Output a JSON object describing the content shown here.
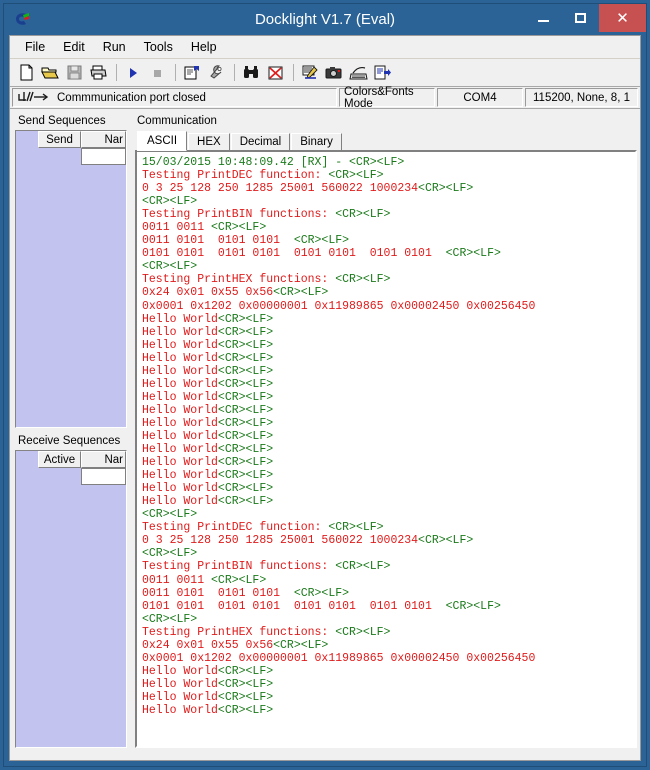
{
  "window": {
    "title": "Docklight V1.7 (Eval)",
    "app_icon": "docklight-logo-icon",
    "controls": {
      "minimize": "minimize-icon",
      "maximize": "maximize-icon",
      "close": "✕"
    }
  },
  "menubar": {
    "items": [
      {
        "label": "File"
      },
      {
        "label": "Edit"
      },
      {
        "label": "Run"
      },
      {
        "label": "Tools"
      },
      {
        "label": "Help"
      }
    ]
  },
  "toolbar": {
    "buttons": [
      {
        "name": "new-file-icon",
        "title": "New"
      },
      {
        "name": "open-file-icon",
        "title": "Open"
      },
      {
        "name": "save-file-icon",
        "title": "Save",
        "disabled": true
      },
      {
        "name": "print-icon",
        "title": "Print"
      },
      {
        "name": "start-communication-icon",
        "title": "Start Communication"
      },
      {
        "name": "stop-communication-icon",
        "title": "Stop Communication",
        "disabled": true
      },
      {
        "name": "project-settings-icon",
        "title": "Project Settings"
      },
      {
        "name": "tools-wrench-icon",
        "title": "Tools"
      },
      {
        "name": "find-binoculars-icon",
        "title": "Find"
      },
      {
        "name": "clear-communication-icon",
        "title": "Clear Communication Window"
      },
      {
        "name": "edit-mode-icon",
        "title": "Edit Mode"
      },
      {
        "name": "snapshot-camera-icon",
        "title": "Snapshot"
      },
      {
        "name": "keyboard-console-icon",
        "title": "Keyboard Console"
      },
      {
        "name": "send-file-icon",
        "title": "Send File"
      }
    ]
  },
  "statusbar": {
    "connection_icon": "serial-link-icon",
    "connection_text": "Commmunication port closed",
    "mode": "Colors&Fonts Mode",
    "port": "COM4",
    "params": "115200, None, 8, 1"
  },
  "send_sequences": {
    "title": "Send Sequences",
    "columns": [
      "Send",
      "Nar"
    ]
  },
  "receive_sequences": {
    "title": "Receive Sequences",
    "columns": [
      "Active",
      "Nar"
    ]
  },
  "communication": {
    "title": "Communication",
    "tabs": [
      {
        "label": "ASCII",
        "active": true
      },
      {
        "label": "HEX",
        "active": false
      },
      {
        "label": "Decimal",
        "active": false
      },
      {
        "label": "Binary",
        "active": false
      }
    ],
    "colors": {
      "data": "#e01b1b",
      "control": "#1a7a1a"
    },
    "lines": [
      [
        {
          "t": "15/03/2015 10:48:09.42 [RX] - <CR><LF>",
          "c": "green"
        }
      ],
      [
        {
          "t": "Testing PrintDEC function: ",
          "c": "red"
        },
        {
          "t": "<CR><LF>",
          "c": "green"
        }
      ],
      [
        {
          "t": "0 3 25 128 250 1285 25001 560022 1000234",
          "c": "red"
        },
        {
          "t": "<CR><LF>",
          "c": "green"
        }
      ],
      [
        {
          "t": "<CR><LF>",
          "c": "green"
        }
      ],
      [
        {
          "t": "Testing PrintBIN functions: ",
          "c": "red"
        },
        {
          "t": "<CR><LF>",
          "c": "green"
        }
      ],
      [
        {
          "t": "0011 0011 ",
          "c": "red"
        },
        {
          "t": "<CR><LF>",
          "c": "green"
        }
      ],
      [
        {
          "t": "0011 0101  0101 0101  ",
          "c": "red"
        },
        {
          "t": "<CR><LF>",
          "c": "green"
        }
      ],
      [
        {
          "t": "0101 0101  0101 0101  0101 0101  0101 0101  ",
          "c": "red"
        },
        {
          "t": "<CR><LF>",
          "c": "green"
        }
      ],
      [
        {
          "t": "<CR><LF>",
          "c": "green"
        }
      ],
      [
        {
          "t": "Testing PrintHEX functions: ",
          "c": "red"
        },
        {
          "t": "<CR><LF>",
          "c": "green"
        }
      ],
      [
        {
          "t": "0x24 0x01 0x55 0x56",
          "c": "red"
        },
        {
          "t": "<CR><LF>",
          "c": "green"
        }
      ],
      [
        {
          "t": "0x0001 0x1202 0x00000001 0x11989865 0x00002450 0x00256450",
          "c": "red"
        }
      ],
      [
        {
          "t": "Hello World",
          "c": "red"
        },
        {
          "t": "<CR><LF>",
          "c": "green"
        }
      ],
      [
        {
          "t": "Hello World",
          "c": "red"
        },
        {
          "t": "<CR><LF>",
          "c": "green"
        }
      ],
      [
        {
          "t": "Hello World",
          "c": "red"
        },
        {
          "t": "<CR><LF>",
          "c": "green"
        }
      ],
      [
        {
          "t": "Hello World",
          "c": "red"
        },
        {
          "t": "<CR><LF>",
          "c": "green"
        }
      ],
      [
        {
          "t": "Hello World",
          "c": "red"
        },
        {
          "t": "<CR><LF>",
          "c": "green"
        }
      ],
      [
        {
          "t": "Hello World",
          "c": "red"
        },
        {
          "t": "<CR><LF>",
          "c": "green"
        }
      ],
      [
        {
          "t": "Hello World",
          "c": "red"
        },
        {
          "t": "<CR><LF>",
          "c": "green"
        }
      ],
      [
        {
          "t": "Hello World",
          "c": "red"
        },
        {
          "t": "<CR><LF>",
          "c": "green"
        }
      ],
      [
        {
          "t": "Hello World",
          "c": "red"
        },
        {
          "t": "<CR><LF>",
          "c": "green"
        }
      ],
      [
        {
          "t": "Hello World",
          "c": "red"
        },
        {
          "t": "<CR><LF>",
          "c": "green"
        }
      ],
      [
        {
          "t": "Hello World",
          "c": "red"
        },
        {
          "t": "<CR><LF>",
          "c": "green"
        }
      ],
      [
        {
          "t": "Hello World",
          "c": "red"
        },
        {
          "t": "<CR><LF>",
          "c": "green"
        }
      ],
      [
        {
          "t": "Hello World",
          "c": "red"
        },
        {
          "t": "<CR><LF>",
          "c": "green"
        }
      ],
      [
        {
          "t": "Hello World",
          "c": "red"
        },
        {
          "t": "<CR><LF>",
          "c": "green"
        }
      ],
      [
        {
          "t": "Hello World",
          "c": "red"
        },
        {
          "t": "<CR><LF>",
          "c": "green"
        }
      ],
      [
        {
          "t": "<CR><LF>",
          "c": "green"
        }
      ],
      [
        {
          "t": "Testing PrintDEC function: ",
          "c": "red"
        },
        {
          "t": "<CR><LF>",
          "c": "green"
        }
      ],
      [
        {
          "t": "0 3 25 128 250 1285 25001 560022 1000234",
          "c": "red"
        },
        {
          "t": "<CR><LF>",
          "c": "green"
        }
      ],
      [
        {
          "t": "<CR><LF>",
          "c": "green"
        }
      ],
      [
        {
          "t": "Testing PrintBIN functions: ",
          "c": "red"
        },
        {
          "t": "<CR><LF>",
          "c": "green"
        }
      ],
      [
        {
          "t": "0011 0011 ",
          "c": "red"
        },
        {
          "t": "<CR><LF>",
          "c": "green"
        }
      ],
      [
        {
          "t": "0011 0101  0101 0101  ",
          "c": "red"
        },
        {
          "t": "<CR><LF>",
          "c": "green"
        }
      ],
      [
        {
          "t": "0101 0101  0101 0101  0101 0101  0101 0101  ",
          "c": "red"
        },
        {
          "t": "<CR><LF>",
          "c": "green"
        }
      ],
      [
        {
          "t": "<CR><LF>",
          "c": "green"
        }
      ],
      [
        {
          "t": "Testing PrintHEX functions: ",
          "c": "red"
        },
        {
          "t": "<CR><LF>",
          "c": "green"
        }
      ],
      [
        {
          "t": "0x24 0x01 0x55 0x56",
          "c": "red"
        },
        {
          "t": "<CR><LF>",
          "c": "green"
        }
      ],
      [
        {
          "t": "0x0001 0x1202 0x00000001 0x11989865 0x00002450 0x00256450",
          "c": "red"
        }
      ],
      [
        {
          "t": "Hello World",
          "c": "red"
        },
        {
          "t": "<CR><LF>",
          "c": "green"
        }
      ],
      [
        {
          "t": "Hello World",
          "c": "red"
        },
        {
          "t": "<CR><LF>",
          "c": "green"
        }
      ],
      [
        {
          "t": "Hello World",
          "c": "red"
        },
        {
          "t": "<CR><LF>",
          "c": "green"
        }
      ],
      [
        {
          "t": "Hello World",
          "c": "red"
        },
        {
          "t": "<CR><LF>",
          "c": "green"
        }
      ]
    ]
  }
}
